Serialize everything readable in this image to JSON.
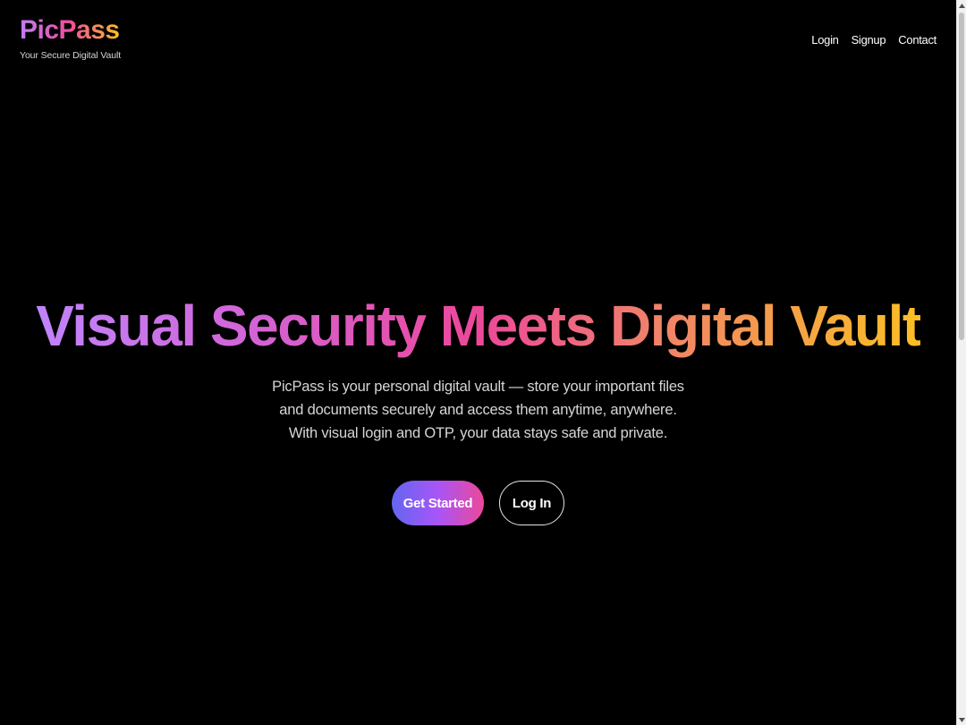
{
  "brand": {
    "logo": "PicPass",
    "tagline": "Your Secure Digital Vault"
  },
  "nav": {
    "items": [
      {
        "label": "Login"
      },
      {
        "label": "Signup"
      },
      {
        "label": "Contact"
      }
    ]
  },
  "hero": {
    "headline": "Visual Security Meets Digital Vault",
    "description": "PicPass is your personal digital vault — store your important files and documents securely and access them anytime, anywhere. With visual login and OTP, your data stays safe and private.",
    "primary_cta": "Get Started",
    "secondary_cta": "Log In"
  },
  "colors": {
    "background": "#000000",
    "gradient_start": "#c084fc",
    "gradient_mid": "#ec4899",
    "gradient_end": "#fbbf24",
    "button_gradient_start": "#6366f1",
    "button_gradient_end": "#ec4899"
  },
  "icons": {
    "scroll_up": "scroll-up-arrow-icon",
    "scroll_down": "scroll-down-arrow-icon"
  }
}
